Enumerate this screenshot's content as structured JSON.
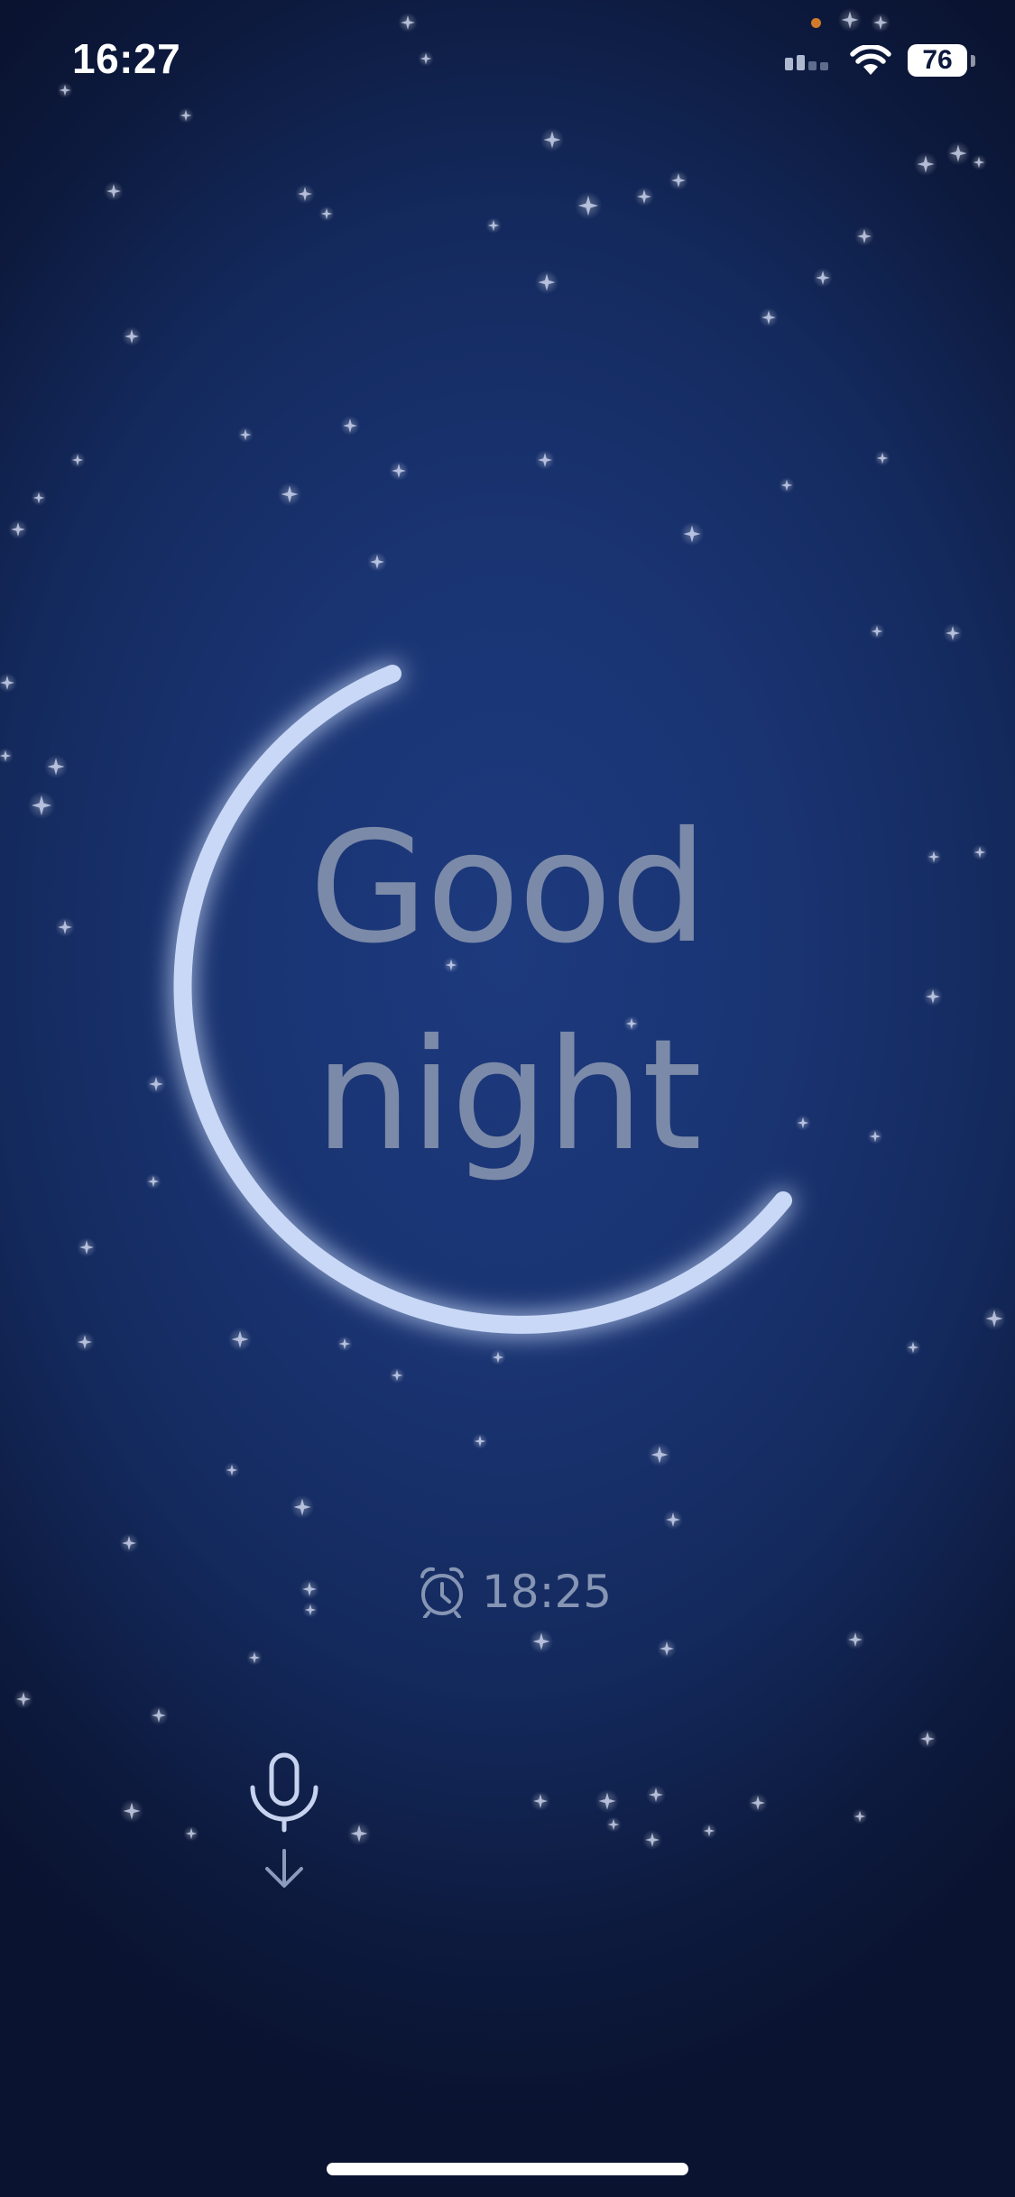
{
  "status_bar": {
    "time": "16:27",
    "battery_level": "76",
    "signal_icon": "cellular-signal-icon",
    "wifi_icon": "wifi-icon"
  },
  "greeting": {
    "line1": "Good",
    "line2": "night"
  },
  "alarm": {
    "icon": "alarm-clock-icon",
    "time": "18:25"
  },
  "controls": {
    "mic_icon": "microphone-download-icon"
  },
  "colors": {
    "background": "#142a5e",
    "ring": "#c8d8f6",
    "greeting_text": "#7b8aa8",
    "alarm_text": "#8695b3"
  }
}
